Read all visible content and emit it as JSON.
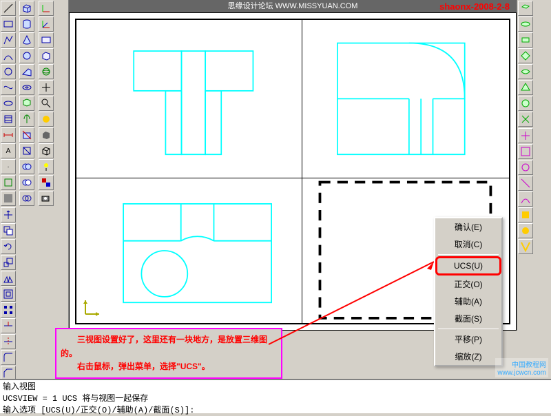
{
  "title": "思缘设计论坛 WWW.MISSYUAN.COM",
  "watermark_tr": "shaonx-2008-2-8",
  "watermark_br_1": "中国教程网",
  "watermark_br_2": "www.jcwcn.com",
  "context_menu": {
    "items": [
      {
        "label": "确认(E)",
        "name": "menu-confirm"
      },
      {
        "label": "取消(C)",
        "name": "menu-cancel"
      },
      {
        "label": "UCS(U)",
        "name": "menu-ucs",
        "highlight": true
      },
      {
        "label": "正交(O)",
        "name": "menu-ortho"
      },
      {
        "label": "辅助(A)",
        "name": "menu-assist"
      },
      {
        "label": "截面(S)",
        "name": "menu-section"
      },
      {
        "label": "平移(P)",
        "name": "menu-pan"
      },
      {
        "label": "缩放(Z)",
        "name": "menu-zoom"
      }
    ]
  },
  "annotation": {
    "line1": "三视图设置好了，这里还有一块地方，是放置三维图的。",
    "line2": "右击鼠标，弹出菜单，选择\"UCS\"。"
  },
  "cmd": {
    "line1": "输入视图",
    "line2": "UCSVIEW = 1   UCS 将与视图一起保存",
    "line3": "输入选项 [UCS(U)/正交(O)/辅助(A)/截面(S)]:"
  }
}
